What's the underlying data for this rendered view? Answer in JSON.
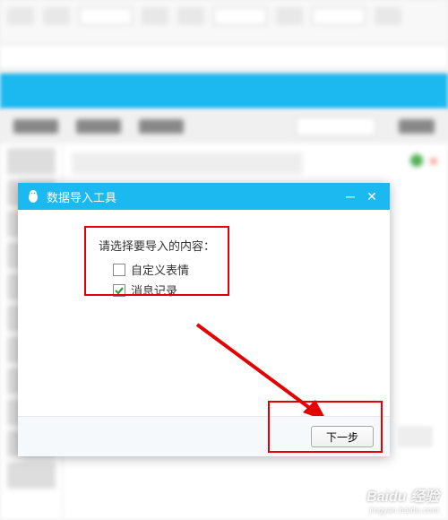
{
  "dialog": {
    "title": "数据导入工具",
    "prompt": "请选择要导入的内容：",
    "options": [
      {
        "label": "自定义表情",
        "checked": false
      },
      {
        "label": "消息记录",
        "checked": true
      }
    ],
    "next_button": "下一步"
  },
  "watermark": {
    "brand": "Baidu 经验",
    "url": "jingyan.baidu.com"
  }
}
